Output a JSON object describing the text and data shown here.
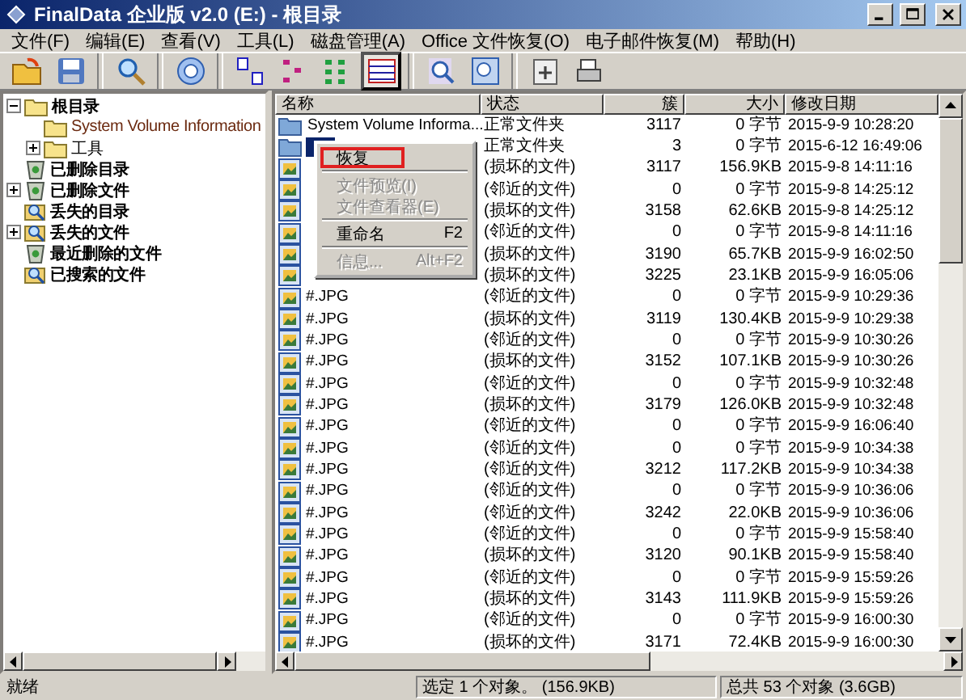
{
  "window": {
    "title": "FinalData 企业版 v2.0 (E:) - 根目录"
  },
  "menu": [
    "文件(F)",
    "编辑(E)",
    "查看(V)",
    "工具(L)",
    "磁盘管理(A)",
    "Office 文件恢复(O)",
    "电子邮件恢复(M)",
    "帮助(H)"
  ],
  "tree": [
    {
      "label": "根目录",
      "kind": "folder",
      "expanded": true,
      "children": [
        {
          "label": "System Volume Information",
          "kind": "folder"
        },
        {
          "label": "工具",
          "kind": "folder",
          "expanded": false
        }
      ]
    },
    {
      "label": "已删除目录",
      "kind": "trash"
    },
    {
      "label": "已删除文件",
      "kind": "trash",
      "expanded": false
    },
    {
      "label": "丢失的目录",
      "kind": "lost"
    },
    {
      "label": "丢失的文件",
      "kind": "lost",
      "expanded": false
    },
    {
      "label": "最近删除的文件",
      "kind": "trash"
    },
    {
      "label": "已搜索的文件",
      "kind": "search"
    }
  ],
  "table": {
    "columns": [
      "名称",
      "状态",
      "簇",
      "大小",
      "修改日期"
    ],
    "rows": [
      {
        "kind": "folder",
        "selected": false,
        "name": "System Volume Informa...",
        "status": "正常文件夹",
        "clusters": "3117",
        "size": "0 字节",
        "modified": "2015-9-9 10:28:20"
      },
      {
        "kind": "folder",
        "selected": true,
        "status": "正常文件夹",
        "clusters": "3",
        "size": "0 字节",
        "modified": "2015-6-12 16:49:06"
      },
      {
        "kind": "image",
        "status": "(损坏的文件)",
        "clusters": "3117",
        "size": "156.9KB",
        "modified": "2015-9-8 14:11:16"
      },
      {
        "kind": "image",
        "status": "(邻近的文件)",
        "clusters": "0",
        "size": "0 字节",
        "modified": "2015-9-8 14:25:12"
      },
      {
        "kind": "image",
        "status": "(损坏的文件)",
        "clusters": "3158",
        "size": "62.6KB",
        "modified": "2015-9-8 14:25:12"
      },
      {
        "kind": "image",
        "status": "(邻近的文件)",
        "clusters": "0",
        "size": "0 字节",
        "modified": "2015-9-8 14:11:16"
      },
      {
        "kind": "image",
        "status": "(损坏的文件)",
        "clusters": "3190",
        "size": "65.7KB",
        "modified": "2015-9-9 16:02:50"
      },
      {
        "kind": "image",
        "status": "(损坏的文件)",
        "clusters": "3225",
        "size": "23.1KB",
        "modified": "2015-9-9 16:05:06"
      },
      {
        "kind": "image",
        "selected": false,
        "name": "#.JPG",
        "status": "(邻近的文件)",
        "clusters": "0",
        "size": "0 字节",
        "modified": "2015-9-9 10:29:36"
      },
      {
        "kind": "image",
        "selected": false,
        "name": "#.JPG",
        "status": "(损坏的文件)",
        "clusters": "3119",
        "size": "130.4KB",
        "modified": "2015-9-9 10:29:38"
      },
      {
        "kind": "image",
        "selected": false,
        "name": "#.JPG",
        "status": "(邻近的文件)",
        "clusters": "0",
        "size": "0 字节",
        "modified": "2015-9-9 10:30:26"
      },
      {
        "kind": "image",
        "selected": false,
        "name": "#.JPG",
        "status": "(损坏的文件)",
        "clusters": "3152",
        "size": "107.1KB",
        "modified": "2015-9-9 10:30:26"
      },
      {
        "kind": "image",
        "selected": false,
        "name": "#.JPG",
        "status": "(邻近的文件)",
        "clusters": "0",
        "size": "0 字节",
        "modified": "2015-9-9 10:32:48"
      },
      {
        "kind": "image",
        "selected": false,
        "name": "#.JPG",
        "status": "(损坏的文件)",
        "clusters": "3179",
        "size": "126.0KB",
        "modified": "2015-9-9 10:32:48"
      },
      {
        "kind": "image",
        "selected": false,
        "name": "#.JPG",
        "status": "(邻近的文件)",
        "clusters": "0",
        "size": "0 字节",
        "modified": "2015-9-9 16:06:40"
      },
      {
        "kind": "image",
        "selected": false,
        "name": "#.JPG",
        "status": "(邻近的文件)",
        "clusters": "0",
        "size": "0 字节",
        "modified": "2015-9-9 10:34:38"
      },
      {
        "kind": "image",
        "selected": false,
        "name": "#.JPG",
        "status": "(邻近的文件)",
        "clusters": "3212",
        "size": "117.2KB",
        "modified": "2015-9-9 10:34:38"
      },
      {
        "kind": "image",
        "selected": false,
        "name": "#.JPG",
        "status": "(邻近的文件)",
        "clusters": "0",
        "size": "0 字节",
        "modified": "2015-9-9 10:36:06"
      },
      {
        "kind": "image",
        "selected": false,
        "name": "#.JPG",
        "status": "(邻近的文件)",
        "clusters": "3242",
        "size": "22.0KB",
        "modified": "2015-9-9 10:36:06"
      },
      {
        "kind": "image",
        "selected": false,
        "name": "#.JPG",
        "status": "(邻近的文件)",
        "clusters": "0",
        "size": "0 字节",
        "modified": "2015-9-9 15:58:40"
      },
      {
        "kind": "image",
        "selected": false,
        "name": "#.JPG",
        "status": "(损坏的文件)",
        "clusters": "3120",
        "size": "90.1KB",
        "modified": "2015-9-9 15:58:40"
      },
      {
        "kind": "image",
        "selected": false,
        "name": "#.JPG",
        "status": "(邻近的文件)",
        "clusters": "0",
        "size": "0 字节",
        "modified": "2015-9-9 15:59:26"
      },
      {
        "kind": "image",
        "selected": false,
        "name": "#.JPG",
        "status": "(损坏的文件)",
        "clusters": "3143",
        "size": "111.9KB",
        "modified": "2015-9-9 15:59:26"
      },
      {
        "kind": "image",
        "selected": false,
        "name": "#.JPG",
        "status": "(邻近的文件)",
        "clusters": "0",
        "size": "0 字节",
        "modified": "2015-9-9 16:00:30"
      },
      {
        "kind": "image",
        "selected": false,
        "name": "#.JPG",
        "status": "(损坏的文件)",
        "clusters": "3171",
        "size": "72.4KB",
        "modified": "2015-9-9 16:00:30"
      }
    ]
  },
  "context_menu": {
    "items": [
      {
        "kind": "item",
        "label": "恢复",
        "selected": true,
        "disabled": false
      },
      {
        "kind": "separator"
      },
      {
        "kind": "item",
        "label": "文件预览(I)",
        "selected": false,
        "disabled": true
      },
      {
        "kind": "item",
        "label": "文件查看器(E)",
        "selected": false,
        "disabled": true
      },
      {
        "kind": "separator"
      },
      {
        "kind": "item",
        "label": "重命名",
        "shortcut": "F2",
        "selected": false,
        "disabled": false
      },
      {
        "kind": "separator"
      },
      {
        "kind": "item",
        "label": "信息...",
        "shortcut": "Alt+F2",
        "selected": false,
        "disabled": true
      }
    ]
  },
  "status_bar": [
    "就绪",
    "选定 1 个对象。 (156.9KB)",
    "总共 53 个对象 (3.6GB)"
  ]
}
